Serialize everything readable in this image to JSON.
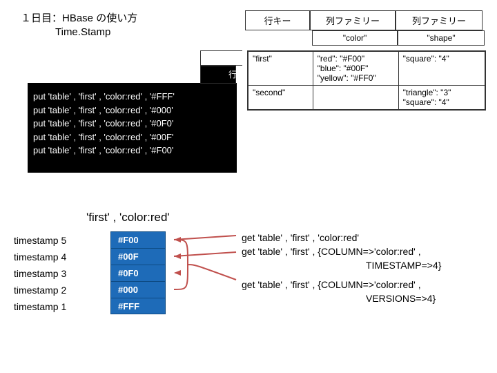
{
  "title": "１日目：HBase の使い方",
  "subtitle": "Time.Stamp",
  "top_headers": {
    "c1": "行キー",
    "c2": "列ファミリー",
    "c3": "列ファミリー"
  },
  "sub_headers": {
    "c2": "\"color\"",
    "c3": "\"shape\""
  },
  "data_rows": {
    "r1": {
      "c1": "\"first\"",
      "c2": "\"red\": \"#F00\"\n\"blue\": \"#00F\"\n\"yellow\": \"#FF0\"",
      "c3": "\"square\": \"4\""
    },
    "r2": {
      "c1": "\"second\"",
      "c2": "",
      "c3": "\"triangle\": \"3\"\n\"square\": \"4\""
    }
  },
  "code_lines": [
    "put 'table' , 'first' , 'color:red' , '#FFF'",
    "put 'table' , 'first' , 'color:red' , '#000'",
    "put 'table' , 'first' , 'color:red' , '#0F0'",
    "put 'table' , 'first' , 'color:red' , '#00F'",
    "put 'table' , 'first' , 'color:red' , '#F00'"
  ],
  "timeline_header": "'first' , 'color:red'",
  "timeline": [
    {
      "ts": "timestamp 5",
      "val": "#F00"
    },
    {
      "ts": "timestamp 4",
      "val": "#00F"
    },
    {
      "ts": "timestamp 3",
      "val": "#0F0"
    },
    {
      "ts": "timestamp 2",
      "val": "#000"
    },
    {
      "ts": "timestamp 1",
      "val": "#FFF"
    }
  ],
  "gets": {
    "g1": "get 'table' , 'first' , 'color:red'",
    "g2a": "get 'table' , 'first' , {COLUMN=>'color:red' ,",
    "g2b": "TIMESTAMP=>4}",
    "g3a": "get 'table' , 'first' , {COLUMN=>'color:red' ,",
    "g3b": "VERSIONS=>4}"
  },
  "chart_data": {
    "type": "table",
    "title": "HBase Time.Stamp versioning",
    "timestamps": [
      {
        "ts": 5,
        "value": "#F00"
      },
      {
        "ts": 4,
        "value": "#00F"
      },
      {
        "ts": 3,
        "value": "#0F0"
      },
      {
        "ts": 2,
        "value": "#000"
      },
      {
        "ts": 1,
        "value": "#FFF"
      }
    ]
  }
}
